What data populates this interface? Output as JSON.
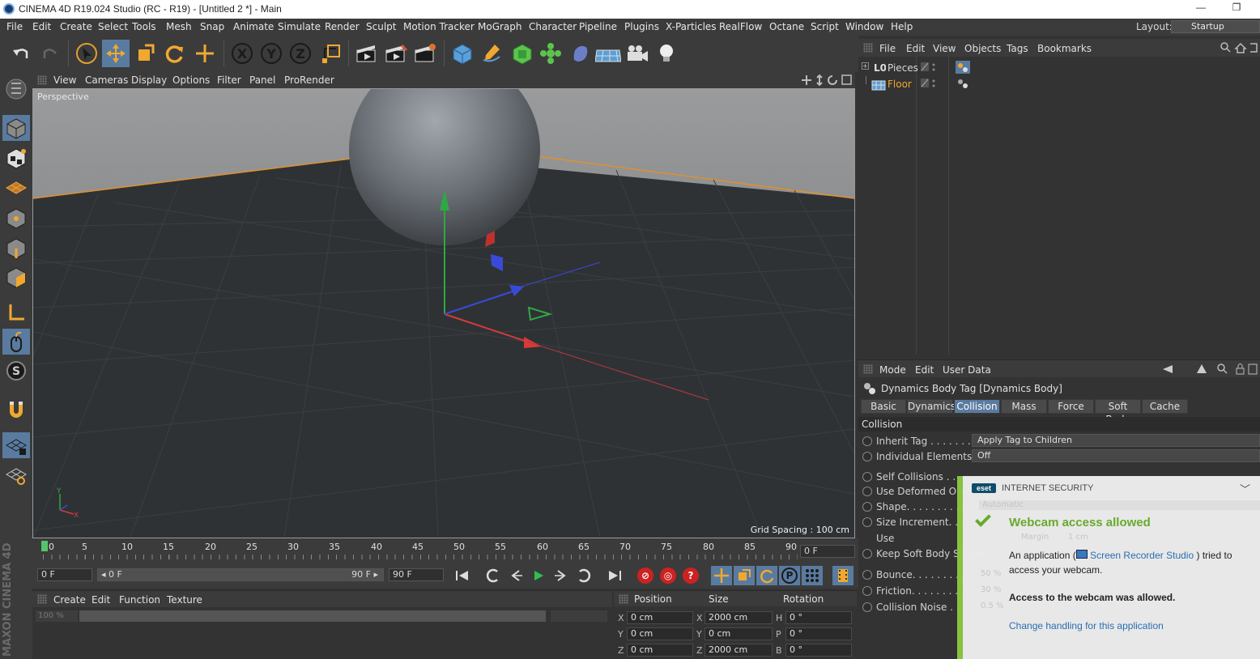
{
  "window": {
    "title": "CINEMA 4D R19.024 Studio (RC - R19) - [Untitled 2 *] - Main",
    "minimize_glyph": "—",
    "restore_glyph": "❐"
  },
  "menu": [
    "File",
    "Edit",
    "Create",
    "Select",
    "Tools",
    "Mesh",
    "Snap",
    "Animate",
    "Simulate",
    "Render",
    "Sculpt",
    "Motion Tracker",
    "MoGraph",
    "Character",
    "Pipeline",
    "Plugins",
    "X-Particles",
    "RealFlow",
    "Octane",
    "Script",
    "Window",
    "Help"
  ],
  "layout": {
    "label": "Layout:",
    "value": "Startup"
  },
  "toolbar": {
    "undo_icon": "undo-icon",
    "redo_icon": "redo-icon",
    "axis_x": "X",
    "axis_y": "Y",
    "axis_z": "Z"
  },
  "viewport": {
    "menu": [
      "View",
      "Cameras",
      "Display",
      "Options",
      "Filter",
      "Panel",
      "ProRender"
    ],
    "camera_label": "Perspective",
    "grid_spacing": "Grid Spacing : 100 cm",
    "gizmo_y": "Y",
    "gizmo_x": "X"
  },
  "timeline": {
    "ticks": [
      "0",
      "5",
      "10",
      "15",
      "20",
      "25",
      "30",
      "35",
      "40",
      "45",
      "50",
      "55",
      "60",
      "65",
      "70",
      "75",
      "80",
      "85",
      "90"
    ],
    "current_frame_field": "0 F",
    "start_field": "0 F",
    "range_start": "◂ 0 F",
    "range_end": "90 F ▸",
    "end_field": "90 F"
  },
  "transport": {
    "keyframe_label": "P"
  },
  "material_manager": {
    "menu": [
      "Create",
      "Edit",
      "Function",
      "Texture"
    ],
    "zoom": "100 %"
  },
  "coordinates": {
    "headers": [
      "Position",
      "Size",
      "Rotation"
    ],
    "rows": [
      {
        "axis": "X",
        "pos": "0 cm",
        "size_axis": "X",
        "size": "2000 cm",
        "rot_axis": "H",
        "rot": "0 °"
      },
      {
        "axis": "Y",
        "pos": "0 cm",
        "size_axis": "Y",
        "size": "0 cm",
        "rot_axis": "P",
        "rot": "0 °"
      },
      {
        "axis": "Z",
        "pos": "0 cm",
        "size_axis": "Z",
        "size": "2000 cm",
        "rot_axis": "B",
        "rot": "0 °"
      }
    ]
  },
  "object_manager": {
    "menu": [
      "File",
      "Edit",
      "View",
      "Objects",
      "Tags",
      "Bookmarks"
    ],
    "objects": [
      {
        "name": "Pieces",
        "color": "#d8d8d8"
      },
      {
        "name": "Floor",
        "color": "#f0a830"
      }
    ]
  },
  "attribute_manager": {
    "menu": [
      "Mode",
      "Edit",
      "User Data"
    ],
    "tag_title": "Dynamics Body Tag [Dynamics Body]",
    "tabs": [
      "Basic",
      "Dynamics",
      "Collision",
      "Mass",
      "Force",
      "Soft Body",
      "Cache"
    ],
    "active_tab": "Collision",
    "section": "Collision",
    "props": [
      {
        "label": "Inherit Tag . . . . . . . . . . .",
        "value": "Apply Tag to Children"
      },
      {
        "label": "Individual Elements . .",
        "value": "Off"
      },
      {
        "label": "Self Collisions . . . . .",
        "value": ""
      },
      {
        "label": "Use Deformed Obje",
        "value": ""
      },
      {
        "label": "Shape. . . . . . . . . . . . . . .",
        "value": ""
      },
      {
        "label": "Size Increment. . . . . .",
        "value": ""
      },
      {
        "label": "Use",
        "value": ""
      },
      {
        "label": "Keep Soft Body Shape",
        "value": ""
      },
      {
        "label": "Bounce. . . . . . . . . . . . .",
        "value": ""
      },
      {
        "label": "Friction. . . . . . . . . . . . .",
        "value": ""
      },
      {
        "label": "Collision Noise . . . . . .",
        "value": ""
      }
    ],
    "shape_value": "Automatic",
    "margin_label": "Margin",
    "margin_value": "1 cm",
    "bounce_value": "50 %",
    "friction_value": "30 %",
    "noise_value": "0.5 %"
  },
  "eset": {
    "logo": "eset",
    "product": "INTERNET SECURITY",
    "headline": "Webcam access allowed",
    "line1_pre": "An application (",
    "app_name": "Screen Recorder Studio",
    "line1_post": ") tried to",
    "line2": "access your webcam.",
    "bold_line": "Access to the webcam was allowed.",
    "change_link": "Change handling for this application"
  },
  "branding": {
    "vertical_text": "MAXON CINEMA 4D"
  },
  "colors": {
    "accent_blue": "#5a7ba0",
    "timeline_marker": "#53c46c",
    "eset_green": "#6aad2c",
    "floor_object": "#f0a830"
  }
}
